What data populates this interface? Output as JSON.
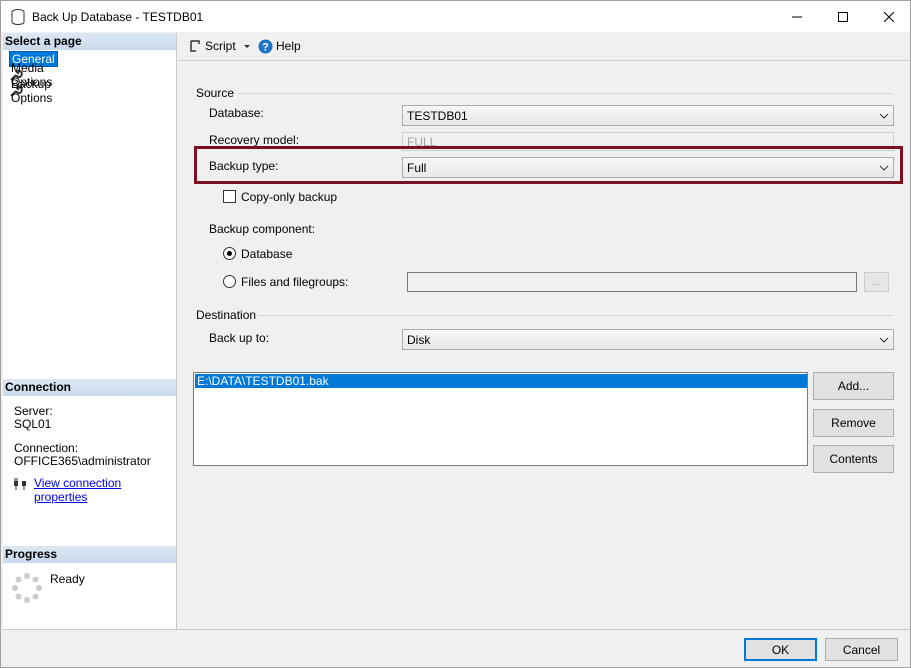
{
  "window": {
    "title": "Back Up Database - TESTDB01"
  },
  "left": {
    "select_page_header": "Select a page",
    "pages": [
      {
        "label": "General",
        "selected": true
      },
      {
        "label": "Media Options",
        "selected": false
      },
      {
        "label": "Backup Options",
        "selected": false
      }
    ],
    "connection_header": "Connection",
    "server_label": "Server:",
    "server_value": "SQL01",
    "connection_label": "Connection:",
    "connection_value": "OFFICE365\\administrator",
    "view_properties": "View connection properties",
    "progress_header": "Progress",
    "progress_status": "Ready"
  },
  "toolbar": {
    "script_label": "Script",
    "help_label": "Help"
  },
  "source": {
    "group_label": "Source",
    "database_label": "Database:",
    "database_value": "TESTDB01",
    "recovery_label": "Recovery model:",
    "recovery_value": "FULL",
    "backup_type_label": "Backup type:",
    "backup_type_value": "Full",
    "copy_only_label": "Copy-only backup",
    "copy_only_checked": false,
    "component_label": "Backup component:",
    "component_database": "Database",
    "component_files": "Files and filegroups:",
    "files_button": "..."
  },
  "destination": {
    "group_label": "Destination",
    "backup_to_label": "Back up to:",
    "backup_to_value": "Disk",
    "paths": [
      "E:\\DATA\\TESTDB01.bak"
    ],
    "add_button": "Add...",
    "remove_button": "Remove",
    "contents_button": "Contents"
  },
  "footer": {
    "ok": "OK",
    "cancel": "Cancel"
  },
  "colors": {
    "accent": "#0078d7",
    "highlight_border": "#7b1022"
  }
}
